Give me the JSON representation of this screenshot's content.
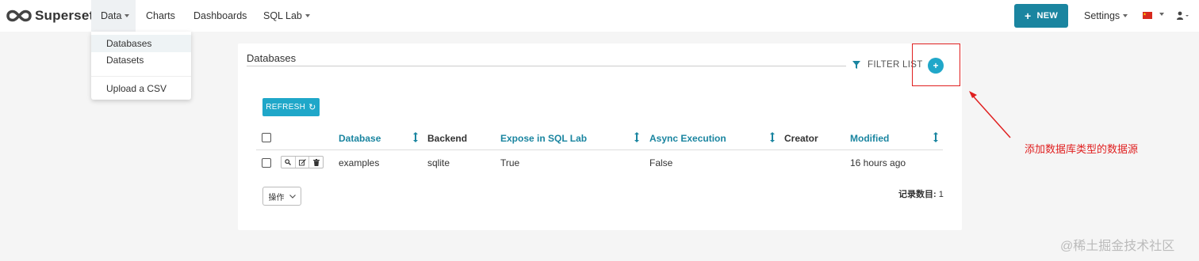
{
  "app": {
    "brand": "Superset"
  },
  "nav": {
    "data": "Data",
    "charts": "Charts",
    "dashboards": "Dashboards",
    "sql_lab": "SQL Lab",
    "new_button": "NEW",
    "settings": "Settings"
  },
  "dropdown": {
    "items": [
      "Databases",
      "Datasets",
      "Upload a CSV"
    ],
    "selected": "Databases"
  },
  "panel": {
    "title": "Databases",
    "filter_list": "FILTER LIST",
    "refresh": "REFRESH"
  },
  "table": {
    "headers": {
      "database": "Database",
      "backend": "Backend",
      "expose": "Expose in SQL Lab",
      "async": "Async Execution",
      "creator": "Creator",
      "modified": "Modified"
    },
    "rows": [
      {
        "database": "examples",
        "backend": "sqlite",
        "expose": "True",
        "async": "False",
        "creator": "",
        "modified": "16 hours ago"
      }
    ]
  },
  "footer": {
    "actions": "操作",
    "record_count_label": "记录数目:",
    "record_count": "1"
  },
  "annotation": {
    "note": "添加数据库类型的数据源",
    "watermark": "@稀土掘金技术社区"
  },
  "colors": {
    "accent": "#1a85a0",
    "accent_light": "#20a7c9",
    "annotation_red": "#e02020"
  }
}
